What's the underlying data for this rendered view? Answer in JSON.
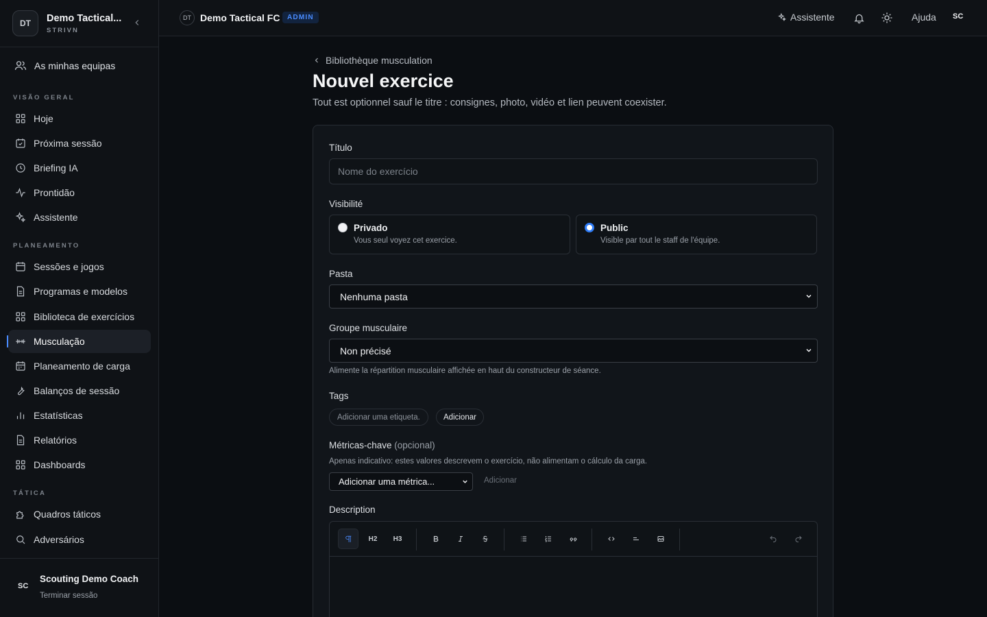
{
  "sidebar": {
    "team_initials": "DT",
    "team_name": "Demo Tactical...",
    "team_sub": "STRIVN",
    "my_teams": "As minhas equipas",
    "sections": {
      "overview": "VISÃO GERAL",
      "planning": "PLANEAMENTO",
      "tactics": "TÁTICA"
    },
    "items": {
      "hoje": "Hoje",
      "proxima": "Próxima sessão",
      "briefing": "Briefing IA",
      "prontidao": "Prontidão",
      "assistente": "Assistente",
      "sessoes": "Sessões e jogos",
      "programas": "Programas e modelos",
      "biblioteca": "Biblioteca de exercícios",
      "musculacao": "Musculação",
      "carga": "Planeamento de carga",
      "balancos": "Balanços de sessão",
      "estatisticas": "Estatísticas",
      "relatorios": "Relatórios",
      "dashboards": "Dashboards",
      "quadros": "Quadros táticos",
      "adversarios": "Adversários"
    },
    "user_initials": "SC",
    "user_name": "Scouting Demo Coach",
    "logout": "Terminar sessão"
  },
  "topbar": {
    "team_initials": "DT",
    "team_name": "Demo Tactical FC",
    "role_badge": "ADMIN",
    "assistant": "Assistente",
    "help": "Ajuda",
    "user_initials": "SC"
  },
  "page": {
    "breadcrumb": "Bibliothèque musculation",
    "title": "Nouvel exercice",
    "subtitle": "Tout est optionnel sauf le titre : consignes, photo, vidéo et lien peuvent coexister."
  },
  "form": {
    "title_label": "Título",
    "title_placeholder": "Nome do exercício",
    "visibility_label": "Visibilité",
    "visibility_private_title": "Privado",
    "visibility_private_desc": "Vous seul voyez cet exercice.",
    "visibility_public_title": "Public",
    "visibility_public_desc": "Visible par tout le staff de l'équipe.",
    "visibility_selected": "Public",
    "folder_label": "Pasta",
    "folder_value": "Nenhuma pasta",
    "muscle_label": "Groupe musculaire",
    "muscle_value": "Non précisé",
    "muscle_hint": "Alimente la répartition musculaire affichée en haut du constructeur de séance.",
    "tags_label": "Tags",
    "tags_placeholder": "Adicionar uma etiqueta.",
    "tags_add": "Adicionar",
    "metrics_label": "Métricas-chave",
    "metrics_optional": "(opcional)",
    "metrics_hint": "Apenas indicativo: estes valores descrevem o exercício, não alimentam o cálculo da carga.",
    "metrics_select": "Adicionar uma métrica...",
    "metrics_add": "Adicionar",
    "description_label": "Description",
    "editor_toolbar": {
      "h2": "H2",
      "h3": "H3"
    }
  },
  "colors": {
    "accent": "#4a8cff",
    "background": "#0b0e12",
    "sidebar": "#0f1216"
  }
}
